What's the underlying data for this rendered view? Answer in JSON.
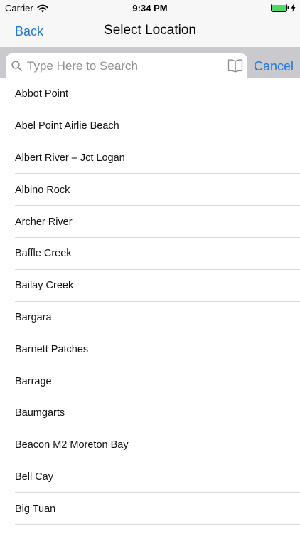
{
  "status_bar": {
    "carrier": "Carrier",
    "time": "9:34 PM"
  },
  "nav": {
    "back_label": "Back",
    "title": "Select Location"
  },
  "search": {
    "placeholder": "Type Here to Search",
    "value": "",
    "cancel_label": "Cancel"
  },
  "locations": [
    "Abbot Point",
    "Abel Point Airlie Beach",
    "Albert River – Jct Logan",
    "Albino Rock",
    "Archer River",
    "Baffle Creek",
    "Bailay Creek",
    "Bargara",
    "Barnett Patches",
    "Barrage",
    "Baumgarts",
    "Beacon M2 Moreton Bay",
    "Bell Cay",
    "Big Tuan"
  ],
  "colors": {
    "accent": "#1f7ad6",
    "bar_background": "#f7f7f7",
    "search_area_background": "#c9c9ce",
    "separator": "#dcdcdc",
    "placeholder": "#8e8e93"
  },
  "icons": {
    "wifi": "wifi-icon",
    "battery": "battery-icon",
    "charging": "charging-bolt-icon",
    "search": "search-icon",
    "bookmark": "book-icon"
  }
}
